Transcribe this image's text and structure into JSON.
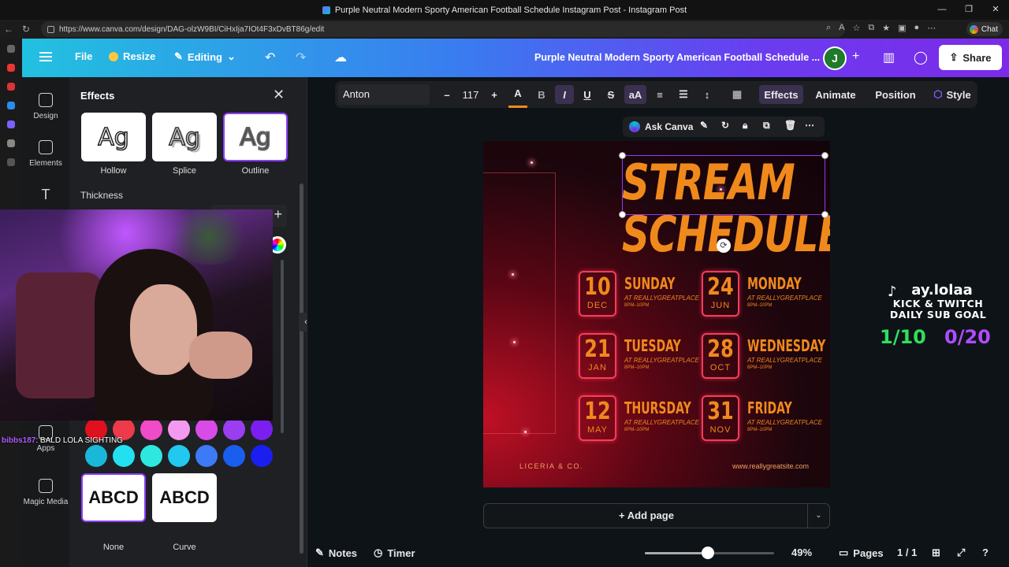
{
  "browser": {
    "window_title": "Purple Neutral Modern Sporty American Football Schedule Instagram Post - Instagram Post",
    "url": "https://www.canva.com/design/DAG-olzW9BI/CiHxIja7IOt4F3xDvBT86g/edit",
    "chat_label": "Chat"
  },
  "header": {
    "file": "File",
    "resize": "Resize",
    "editing": "Editing",
    "doc_title": "Purple Neutral Modern Sporty American Football Schedule ...",
    "avatar": "J",
    "share": "Share"
  },
  "leftnav": {
    "items": [
      {
        "label": "Design",
        "icon": "design-icon"
      },
      {
        "label": "Elements",
        "icon": "elements-icon"
      },
      {
        "label": "Apps",
        "icon": "apps-icon"
      },
      {
        "label": "Magic Media",
        "icon": "magic-media-icon"
      }
    ]
  },
  "effects": {
    "title": "Effects",
    "styles": [
      {
        "label": "Hollow",
        "sample": "Ag"
      },
      {
        "label": "Splice",
        "sample": "Ag"
      },
      {
        "label": "Outline",
        "sample": "Ag"
      }
    ],
    "thickness_label": "Thickness",
    "shapes": [
      {
        "label": "None",
        "sample": "ABCD"
      },
      {
        "label": "Curve",
        "sample": "ABCD"
      }
    ],
    "swatches_row1": [
      "#e0111f",
      "#ee3a4a",
      "#f04bc8",
      "#f39af0",
      "#d94be6",
      "#9b3df0",
      "#7a1ff0"
    ],
    "swatches_row2": [
      "#1ab8d8",
      "#22e0f0",
      "#2ee8e0",
      "#21c8f0",
      "#3c7bf5",
      "#1a5ef0",
      "#1a1ff0"
    ]
  },
  "stream_chat": {
    "user": "bibbs187",
    "message": ": BALD LOLA SIGHTING"
  },
  "toolbar": {
    "font": "Anton",
    "size": "117",
    "minus": "–",
    "plus": "+",
    "bold": "B",
    "italic": "I",
    "underline": "U",
    "strike": "S",
    "case": "aA",
    "effects": "Effects",
    "animate": "Animate",
    "position": "Position",
    "style": "Style"
  },
  "context": {
    "ask_canva": "Ask Canva"
  },
  "poster": {
    "title_line1": "STREAM",
    "title_line2": "SCHEDULE",
    "days": [
      {
        "num": "10",
        "month": "DEC",
        "name": "SUNDAY",
        "place": "AT REALLYGREATPLACE",
        "time": "8PM–10PM"
      },
      {
        "num": "24",
        "month": "JUN",
        "name": "MONDAY",
        "place": "AT REALLYGREATPLACE",
        "time": "8PM–10PM"
      },
      {
        "num": "21",
        "month": "JAN",
        "name": "TUESDAY",
        "place": "AT REALLYGREATPLACE",
        "time": "8PM–10PM"
      },
      {
        "num": "28",
        "month": "OCT",
        "name": "WEDNESDAY",
        "place": "AT REALLYGREATPLACE",
        "time": "8PM–10PM"
      },
      {
        "num": "12",
        "month": "MAY",
        "name": "THURSDAY",
        "place": "AT REALLYGREATPLACE",
        "time": "8PM–10PM"
      },
      {
        "num": "31",
        "month": "NOV",
        "name": "FRIDAY",
        "place": "AT REALLYGREATPLACE",
        "time": "8PM–10PM"
      }
    ],
    "footer_left": "LICERIA & CO.",
    "footer_right": "www.reallygreatsite.com"
  },
  "add_page": "+ Add page",
  "overlay": {
    "handle": "ay.lolaa",
    "goal_line1": "KICK & TWITCH",
    "goal_line2": "DAILY SUB GOAL",
    "count1": "1/10",
    "count2": "0/20"
  },
  "bottombar": {
    "notes": "Notes",
    "timer": "Timer",
    "zoom": "49%",
    "zoom_fraction": 0.49,
    "pages": "Pages",
    "page_count": "1 / 1"
  }
}
